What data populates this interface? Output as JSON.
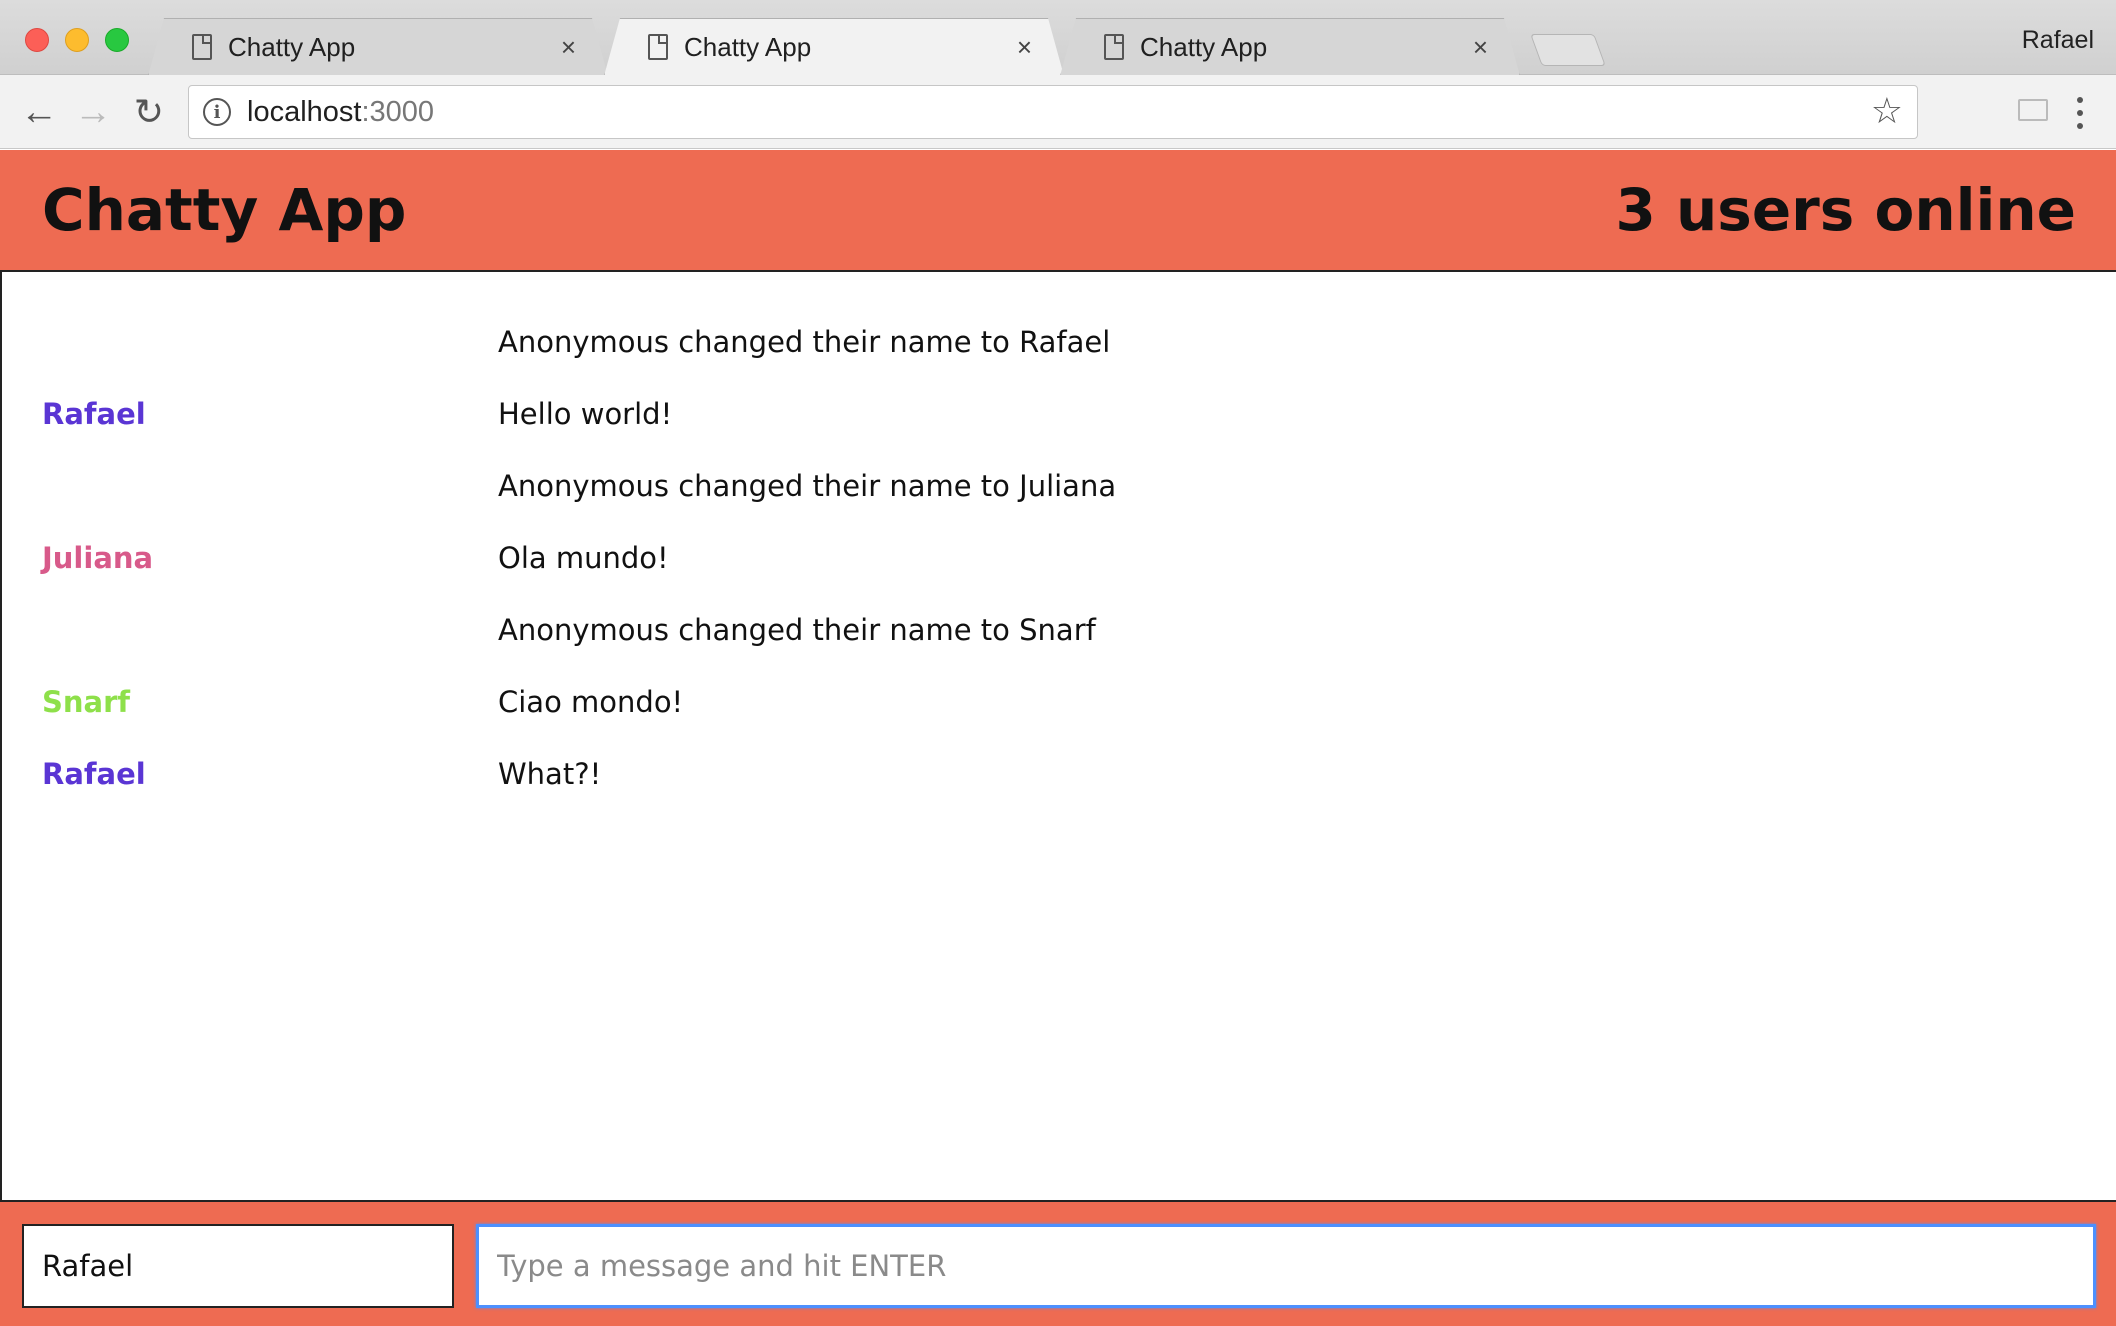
{
  "browser": {
    "tabs": [
      {
        "title": "Chatty App",
        "active": false
      },
      {
        "title": "Chatty App",
        "active": true
      },
      {
        "title": "Chatty App",
        "active": false
      }
    ],
    "profile_name": "Rafael",
    "url": {
      "host": "localhost",
      "port": ":3000"
    },
    "icons": {
      "back": "arrow-left-icon",
      "forward": "arrow-right-icon",
      "reload": "reload-icon",
      "info": "info-icon",
      "bookmark": "star-icon",
      "cast": "cast-icon",
      "menu": "kebab-menu-icon",
      "tab_page": "document-icon",
      "tab_close": "close-icon"
    }
  },
  "app": {
    "title": "Chatty App",
    "users_online": "3 users online",
    "accent_color": "#ee6b52"
  },
  "messages": [
    {
      "type": "notification",
      "username": "",
      "content": "Anonymous changed their name to Rafael",
      "color": "#111111"
    },
    {
      "type": "message",
      "username": "Rafael",
      "content": "Hello world!",
      "color": "#5a35d4"
    },
    {
      "type": "notification",
      "username": "",
      "content": "Anonymous changed their name to Juliana",
      "color": "#111111"
    },
    {
      "type": "message",
      "username": "Juliana",
      "content": "Ola mundo!",
      "color": "#d85a8a"
    },
    {
      "type": "notification",
      "username": "",
      "content": "Anonymous changed their name to Snarf",
      "color": "#111111"
    },
    {
      "type": "message",
      "username": "Snarf",
      "content": "Ciao mondo!",
      "color": "#8ee04a"
    },
    {
      "type": "message",
      "username": "Rafael",
      "content": "What?!",
      "color": "#5a35d4"
    }
  ],
  "chatbar": {
    "username_value": "Rafael",
    "message_placeholder": "Type a message and hit ENTER"
  }
}
